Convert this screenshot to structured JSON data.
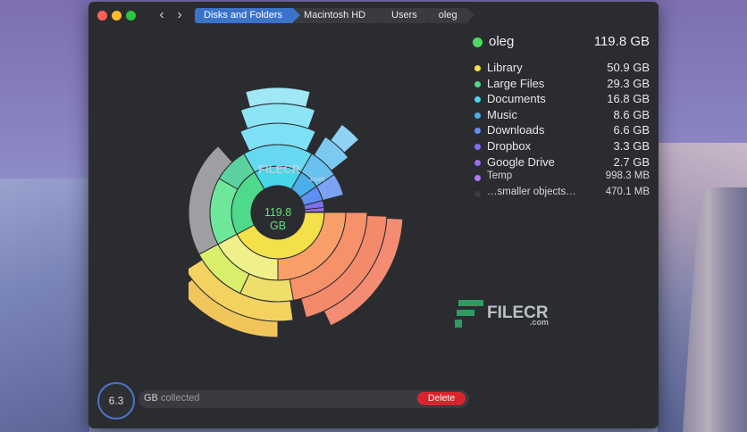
{
  "window": {
    "breadcrumbs": [
      "Disks and Folders",
      "Macintosh HD",
      "Users",
      "oleg"
    ]
  },
  "chart": {
    "center_value": "119.8",
    "center_unit": "GB"
  },
  "legend": {
    "root": {
      "name": "oleg",
      "size": "119.8 GB",
      "color": "#4fd964"
    },
    "items": [
      {
        "name": "Library",
        "size": "50.9 GB",
        "color": "#f3e04a"
      },
      {
        "name": "Large Files",
        "size": "29.3 GB",
        "color": "#4fd98b"
      },
      {
        "name": "Documents",
        "size": "16.8 GB",
        "color": "#49d6e8"
      },
      {
        "name": "Music",
        "size": "8.6 GB",
        "color": "#4aaee8"
      },
      {
        "name": "Downloads",
        "size": "6.6 GB",
        "color": "#5f8ff0"
      },
      {
        "name": "Dropbox",
        "size": "3.3 GB",
        "color": "#7b6ff2"
      },
      {
        "name": "Google Drive",
        "size": "2.7 GB",
        "color": "#9a6ef4"
      },
      {
        "name": "Temp",
        "size": "998.3 MB",
        "color": "#b277f0"
      },
      {
        "name": "…smaller objects…",
        "size": "470.1 MB",
        "color": "#3c3d42"
      }
    ]
  },
  "bottom": {
    "gauge_value": "6.3",
    "collected_unit": "GB",
    "collected_label": "collected",
    "delete_label": "Delete"
  },
  "watermarks": {
    "wm1": "FILECR",
    "wm1_sub": ".com",
    "wm2": "FILECR",
    "wm2_sub": ".com"
  }
}
